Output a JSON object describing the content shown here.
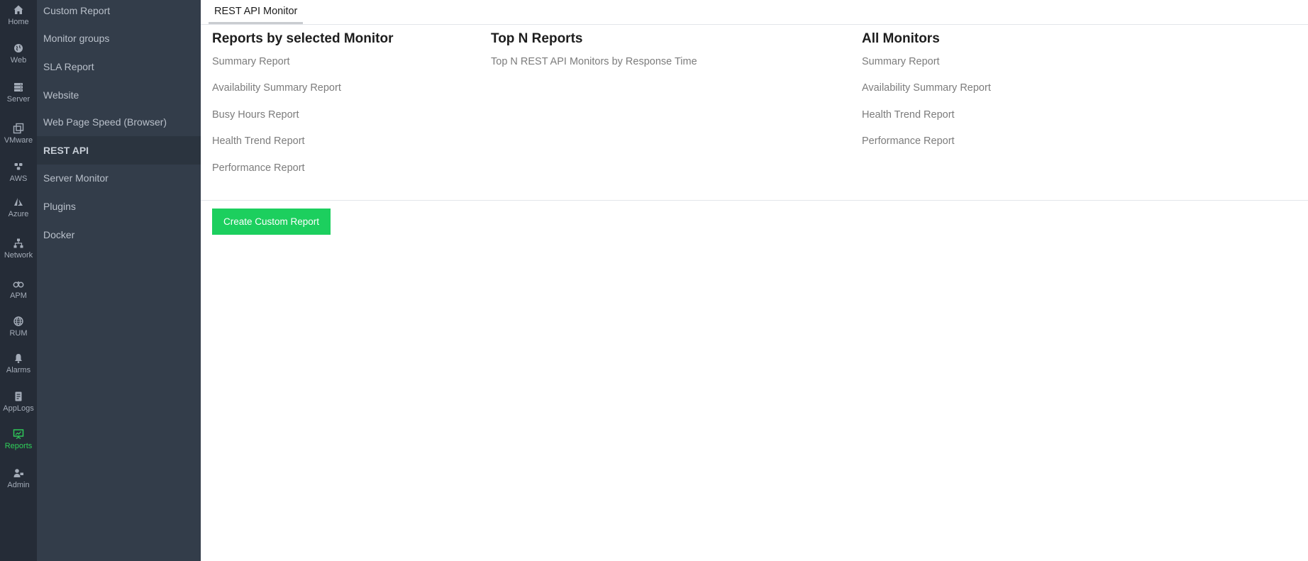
{
  "rail": {
    "items": [
      {
        "label": "Home",
        "icon": "home-icon"
      },
      {
        "label": "Web",
        "icon": "globe-icon"
      },
      {
        "label": "Server",
        "icon": "server-icon"
      },
      {
        "label": "VMware",
        "icon": "vmware-icon"
      },
      {
        "label": "AWS",
        "icon": "aws-icon"
      },
      {
        "label": "Azure",
        "icon": "azure-icon"
      },
      {
        "label": "Network",
        "icon": "network-icon"
      },
      {
        "label": "APM",
        "icon": "binoculars-icon"
      },
      {
        "label": "RUM",
        "icon": "rum-globe-icon"
      },
      {
        "label": "Alarms",
        "icon": "bell-icon"
      },
      {
        "label": "AppLogs",
        "icon": "applogs-icon"
      },
      {
        "label": "Reports",
        "icon": "reports-icon",
        "active": true
      },
      {
        "label": "Admin",
        "icon": "admin-icon"
      }
    ],
    "active_color": "#2fd15a"
  },
  "subnav": {
    "items": [
      {
        "label": "Custom Report"
      },
      {
        "label": "Monitor groups"
      },
      {
        "label": "SLA Report"
      },
      {
        "label": "Website"
      },
      {
        "label": "Web Page Speed (Browser)"
      },
      {
        "label": "REST API",
        "active": true
      },
      {
        "label": "Server Monitor"
      },
      {
        "label": "Plugins"
      },
      {
        "label": "Docker"
      }
    ]
  },
  "tabs": [
    {
      "label": "REST API Monitor",
      "active": true
    }
  ],
  "sections": [
    {
      "title": "Reports by selected Monitor",
      "links": [
        "Summary Report",
        "Availability Summary Report",
        "Busy Hours Report",
        "Health Trend Report",
        "Performance Report"
      ]
    },
    {
      "title": "Top N Reports",
      "links": [
        "Top N REST API Monitors by Response Time"
      ]
    },
    {
      "title": "All Monitors",
      "links": [
        "Summary Report",
        "Availability Summary Report",
        "Health Trend Report",
        "Performance Report"
      ]
    }
  ],
  "create_button": {
    "label": "Create Custom Report",
    "color": "#1ccf5e"
  }
}
